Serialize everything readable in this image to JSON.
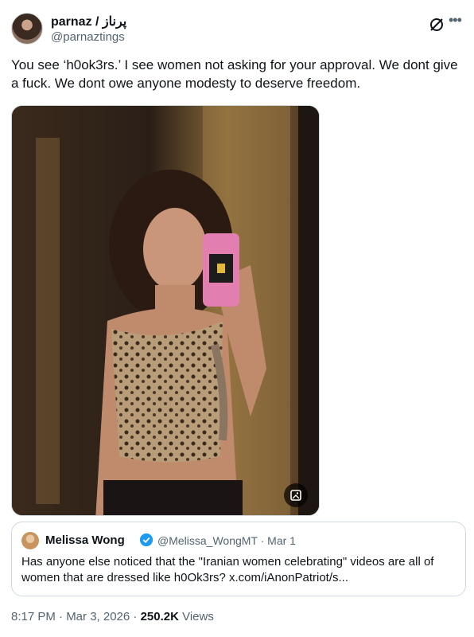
{
  "author": {
    "name": "parnaz / پرناز",
    "handle": "@parnaztings"
  },
  "tweet": {
    "text": "You see ‘h0ok3rs.’ I see women not asking for your approval. We dont give a fuck. We dont owe anyone modesty to deserve freedom."
  },
  "icons": {
    "grok": "grok-icon",
    "more": "more-icon",
    "alt": "image-alt-icon",
    "verified": "verified-badge-icon"
  },
  "quote": {
    "name": "Melissa Wong",
    "handle_date": "@Melissa_WongMT · Mar 1",
    "text": "Has anyone else noticed that the \"Iranian women celebrating\" videos are all of women that are dressed like h0Ok3rs? x.com/iAnonPatriot/s..."
  },
  "meta": {
    "time_date": "8:17 PM · Mar 3, 2026 · ",
    "views_count": "250.2K",
    "views_label": " Views"
  },
  "colors": {
    "text": "#0f1419",
    "muted": "#536471",
    "border": "#cfd9de",
    "verified": "#1d9bf0"
  }
}
